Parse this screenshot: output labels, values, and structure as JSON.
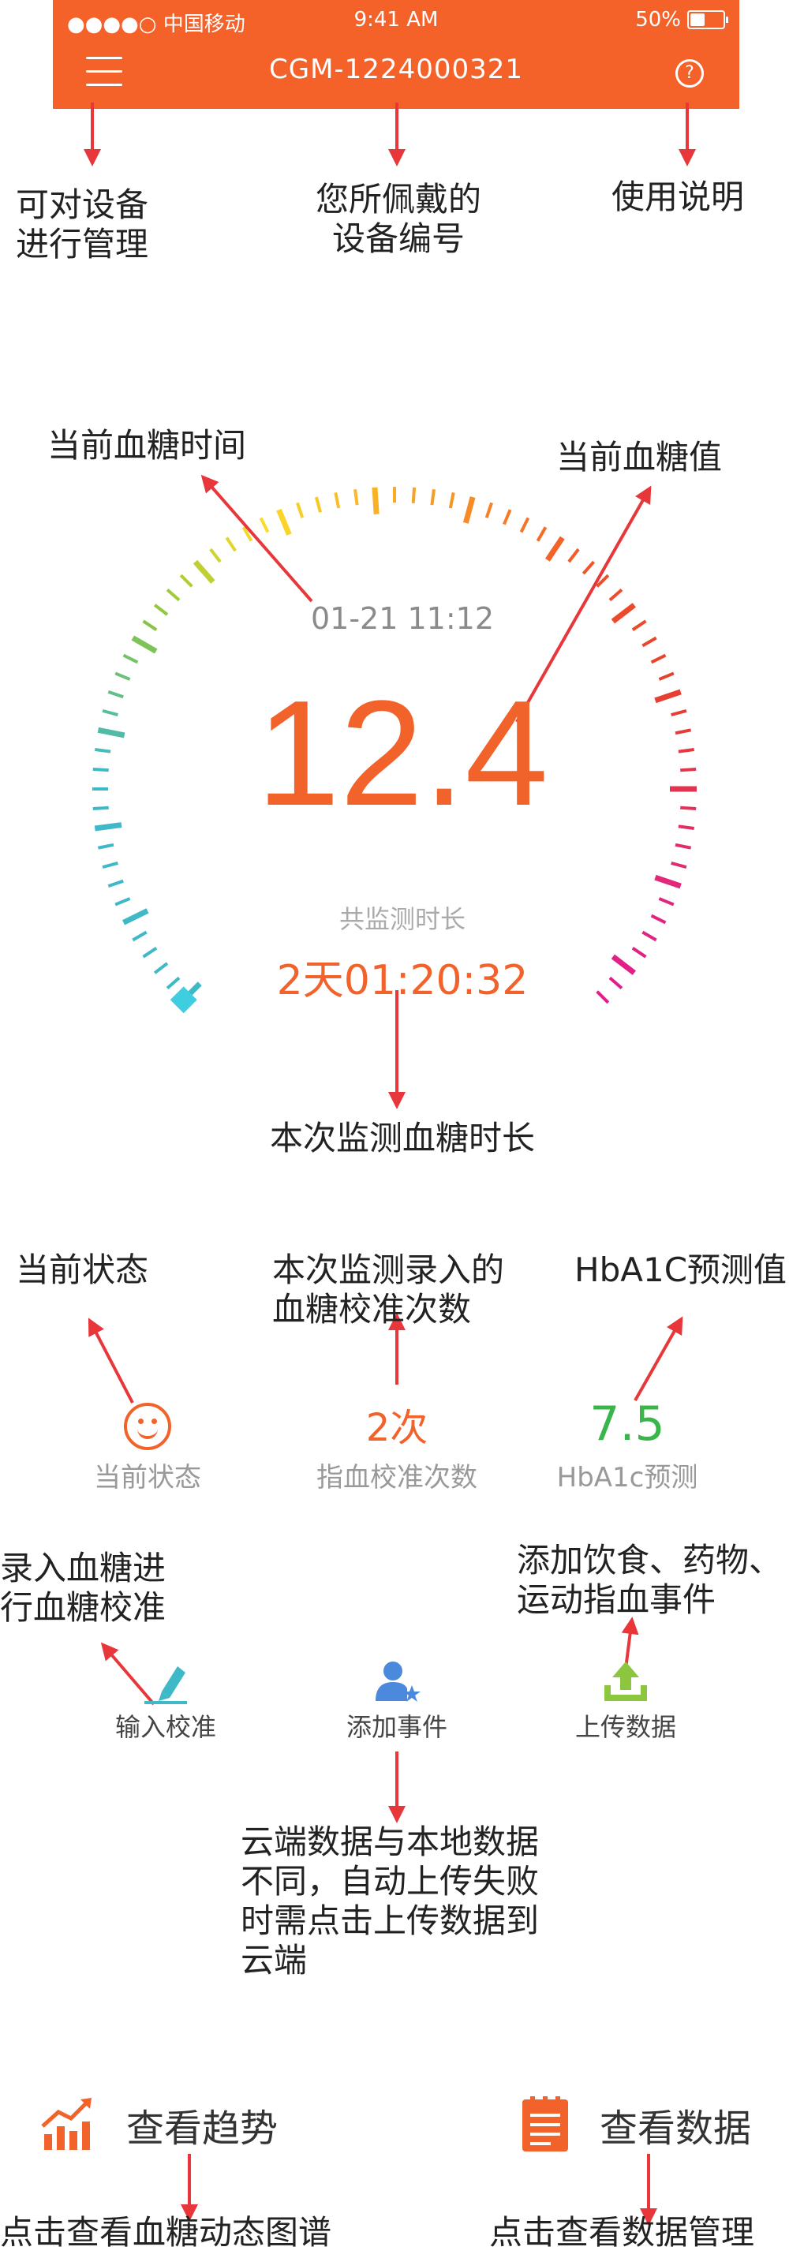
{
  "status_bar": {
    "carrier": "●●●●○ 中国移动",
    "time": "9:41 AM",
    "battery": "50%",
    "battery_level": 0.5
  },
  "nav": {
    "device_id": "CGM-1224000321"
  },
  "annotations": {
    "manage": [
      "可对设备",
      "进行管理"
    ],
    "device_number": [
      "您所佩戴的",
      "设备编号"
    ],
    "help": "使用说明",
    "glucose_time": "当前血糖时间",
    "glucose_value": "当前血糖值",
    "duration": "本次监测血糖时长",
    "current_state": "当前状态",
    "calib_count": [
      "本次监测录入的",
      "血糖校准次数"
    ],
    "hba1c": "HbA1C预测值",
    "input_calib": [
      "录入血糖进",
      "行血糖校准"
    ],
    "add_event": [
      "添加饮食、药物、",
      "运动指血事件"
    ],
    "upload": [
      "云端数据与本地数据",
      "不同，自动上传失败",
      "时需点击上传数据到",
      "云端"
    ],
    "trend": "点击查看血糖动态图谱",
    "data_mgmt": "点击查看数据管理"
  },
  "gauge": {
    "datetime": "01-21  11:12",
    "value": "12.4",
    "duration_label": "共监测时长",
    "duration_value": "2天01:20:32"
  },
  "stats": {
    "state_label": "当前状态",
    "calib_value": "2次",
    "calib_label": "指血校准次数",
    "hba1c_value": "7.5",
    "hba1c_label": "HbA1c预测"
  },
  "actions": {
    "input": "输入校准",
    "event": "添加事件",
    "upload": "上传数据"
  },
  "bottom": {
    "trend": "查看趋势",
    "data": "查看数据"
  },
  "colors": {
    "accent": "#f4622a",
    "arrow": "#e8373a",
    "green": "#39b54a",
    "teal": "#3fb8c8",
    "blue": "#4a89dc"
  }
}
